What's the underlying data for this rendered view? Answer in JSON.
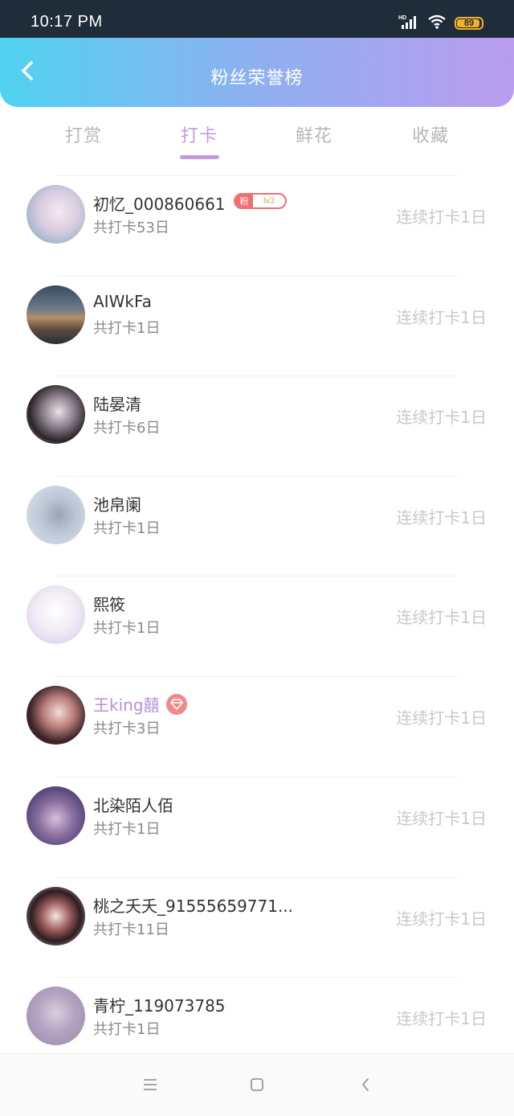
{
  "status_bar": {
    "time": "10:17 PM",
    "battery": "89",
    "icons": [
      "hd-signal-icon",
      "wifi-icon",
      "battery-icon"
    ]
  },
  "header": {
    "title": "粉丝荣誉榜",
    "back_icon": "chevron-left-icon"
  },
  "tabs": [
    {
      "label": "打赏",
      "active": false
    },
    {
      "label": "打卡",
      "active": true
    },
    {
      "label": "鲜花",
      "active": false
    },
    {
      "label": "收藏",
      "active": false
    }
  ],
  "list": [
    {
      "name": "初忆_000860661",
      "total": "共打卡53日",
      "streak": "连续打卡1日",
      "badge": {
        "left": "粉",
        "right": "lv3"
      }
    },
    {
      "name": "AIWkFa",
      "total": "共打卡1日",
      "streak": "连续打卡1日"
    },
    {
      "name": "陆晏清",
      "total": "共打卡6日",
      "streak": "连续打卡1日"
    },
    {
      "name": "池帛阑",
      "total": "共打卡1日",
      "streak": "连续打卡1日"
    },
    {
      "name": "熙筱",
      "total": "共打卡1日",
      "streak": "连续打卡1日"
    },
    {
      "name": "王king囍",
      "total": "共打卡3日",
      "streak": "连续打卡1日",
      "vip": true
    },
    {
      "name": "北染陌人佰",
      "total": "共打卡1日",
      "streak": "连续打卡1日"
    },
    {
      "name": "桃之夭夭_91555659771...",
      "total": "共打卡11日",
      "streak": "连续打卡1日"
    },
    {
      "name": "青柠_119073785",
      "total": "共打卡1日",
      "streak": "连续打卡1日"
    }
  ],
  "colors": {
    "accent": "#c39be0",
    "header_gradient": [
      "#4fd2f0",
      "#b99cee"
    ],
    "vip_name": "#b48fd9",
    "badge": "#f07070"
  },
  "nav_bar": {
    "icons": [
      "menu-icon",
      "home-square-icon",
      "back-triangle-icon"
    ]
  }
}
